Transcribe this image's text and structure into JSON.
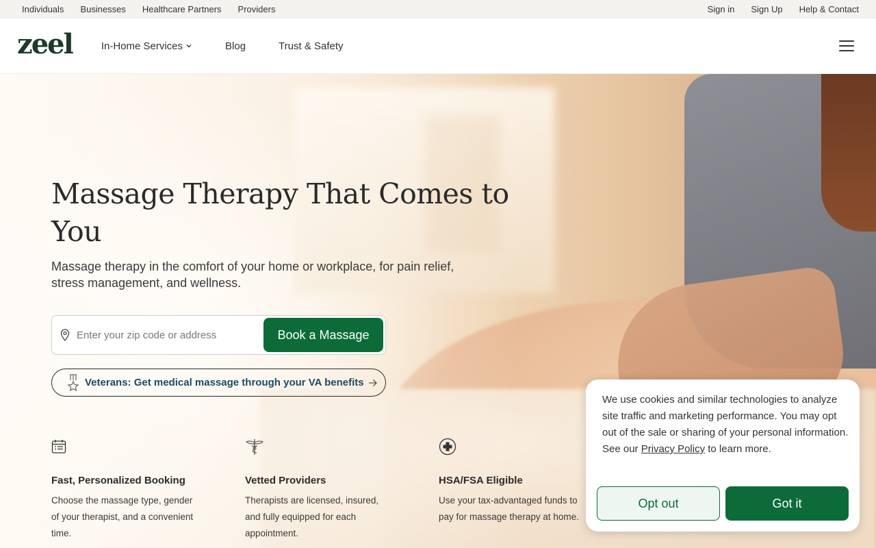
{
  "utility_bar": {
    "left_links": [
      "Individuals",
      "Businesses",
      "Healthcare Partners",
      "Providers"
    ],
    "right_links": [
      "Sign in",
      "Sign Up",
      "Help & Contact"
    ]
  },
  "nav": {
    "logo": "zeel",
    "items": [
      "In-Home Services",
      "Blog",
      "Trust & Safety"
    ]
  },
  "hero": {
    "title": "Massage Therapy That Comes to You",
    "subtitle": "Massage therapy in the comfort of your home or workplace, for pain relief, stress management, and wellness.",
    "search_placeholder": "Enter your zip code or address",
    "book_button": "Book a Massage",
    "veterans_link": "Veterans: Get medical massage through your VA benefits"
  },
  "features": [
    {
      "icon": "calendar-icon",
      "title": "Fast, Personalized Booking",
      "text": "Choose the massage type, gender of your therapist, and a convenient time."
    },
    {
      "icon": "caduceus-icon",
      "title": "Vetted Providers",
      "text": "Therapists are licensed, insured, and fully equipped for each appointment."
    },
    {
      "icon": "medical-cross-icon",
      "title": "HSA/FSA Eligible",
      "text": "Use your tax-advantaged funds to pay for massage therapy at home."
    }
  ],
  "cookie": {
    "text": "We use cookies and similar technologies to analyze site traffic and marketing performance. You may opt out of the sale or sharing of your personal information.",
    "see_our": "See our",
    "privacy_link": "Privacy Policy",
    "learn_more": "to learn more.",
    "opt_out": "Opt out",
    "got_it": "Got it"
  },
  "colors": {
    "brand_green": "#0d6b3a",
    "logo_green": "#1e3a2a",
    "veterans_blue": "#1c4b66"
  }
}
